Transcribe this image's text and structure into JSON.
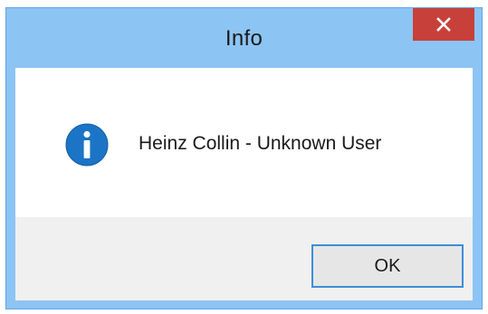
{
  "dialog": {
    "title": "Info",
    "close_icon": "close-icon",
    "message_icon": "info-icon",
    "message": "Heinz Collin - Unknown User",
    "ok_label": "OK"
  },
  "colors": {
    "frame": "#8cc4f4",
    "close_button": "#c8403a",
    "info_icon": "#1b74c5",
    "button_border": "#3c8fd8",
    "button_area": "#f0f0f0"
  }
}
